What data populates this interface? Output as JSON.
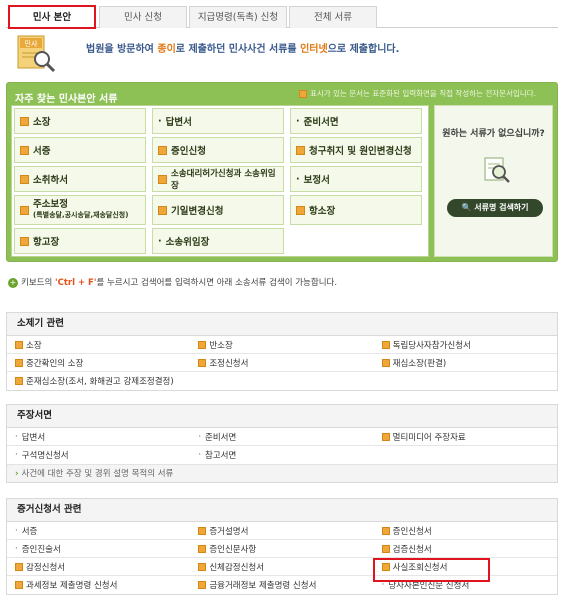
{
  "tabs": [
    {
      "label": "민사 본안"
    },
    {
      "label": "민사 신청"
    },
    {
      "label": "지급명령(독촉) 신청"
    },
    {
      "label": "전체 서류"
    }
  ],
  "intro": {
    "icon_label": "민사",
    "text_a": "법원을 방문하여 ",
    "text_b": "종이",
    "text_c": "로 제출하던 민사사건 서류를 ",
    "text_d": "인터넷",
    "text_e": "으로 제출합니다."
  },
  "favorites": {
    "title": "자주 찾는 민사본안 서류",
    "note": "표시가 있는 문서는 표준화된 입력화면을 직접 작성하는 전자문서입니다.",
    "items": [
      {
        "label": "소장",
        "icon": "doc-icon"
      },
      {
        "label": "답변서",
        "icon": "dot"
      },
      {
        "label": "준비서면",
        "icon": "dot"
      },
      {
        "label": "서증",
        "icon": "doc-icon"
      },
      {
        "label": "증인신청",
        "icon": "doc-icon"
      },
      {
        "label": "청구취지 및 원인변경신청",
        "icon": "doc-icon"
      },
      {
        "label": "소취하서",
        "icon": "doc-icon"
      },
      {
        "label": "소송대리허가신청과 소송위임장",
        "icon": "doc-icon"
      },
      {
        "label": "보정서",
        "icon": "dot"
      },
      {
        "label": "주소보정",
        "sub": "(특별송달,공시송달,재송달신청)",
        "icon": "doc-icon"
      },
      {
        "label": "기일변경신청",
        "icon": "doc-icon"
      },
      {
        "label": "항소장",
        "icon": "doc-icon"
      },
      {
        "label": "항고장",
        "icon": "doc-icon"
      },
      {
        "label": "소송위임장",
        "icon": "dot"
      }
    ],
    "side_text": "원하는 서류가 없으십니까?",
    "search_button": "서류명 검색하기"
  },
  "tip": {
    "a": "키보드의 ",
    "key": "'Ctrl + F'",
    "b": "를 누르시고 검색어를 입력하시면 아래 소송서류 검색이 가능합니다."
  },
  "sections": [
    {
      "title": "소제기 관련",
      "rows": [
        [
          {
            "label": "소장",
            "icon": "doc-icon"
          },
          {
            "label": "반소장",
            "icon": "doc-icon"
          },
          {
            "label": "독립당사자참가신청서",
            "icon": "doc-icon"
          }
        ],
        [
          {
            "label": "중간확인의 소장",
            "icon": "doc-icon"
          },
          {
            "label": "조정신청서",
            "icon": "doc-icon"
          },
          {
            "label": "재심소장(판결)",
            "icon": "doc-icon"
          }
        ],
        [
          {
            "label": "준재심소장(조서, 화해권고 강제조정결정)",
            "icon": "doc-icon"
          },
          {
            "label": "",
            "icon": ""
          },
          {
            "label": "",
            "icon": ""
          }
        ]
      ]
    },
    {
      "title": "주장서면",
      "rows": [
        [
          {
            "label": "답변서",
            "icon": "dot"
          },
          {
            "label": "준비서면",
            "icon": "dot"
          },
          {
            "label": "멀티미디어 주장자료",
            "icon": "doc-icon"
          }
        ],
        [
          {
            "label": "구석명신청서",
            "icon": "dot"
          },
          {
            "label": "참고서면",
            "icon": "dot"
          },
          {
            "label": "",
            "icon": ""
          }
        ]
      ],
      "note": "사건에 대한 주장 및 경위 설명 목적의 서류"
    },
    {
      "title": "증거신청서 관련",
      "rows": [
        [
          {
            "label": "서증",
            "icon": "dot"
          },
          {
            "label": "증거설명서",
            "icon": "doc-icon"
          },
          {
            "label": "증인신청서",
            "icon": "doc-icon"
          }
        ],
        [
          {
            "label": "증인진술서",
            "icon": "dot"
          },
          {
            "label": "증인신문사항",
            "icon": "doc-icon"
          },
          {
            "label": "검증신청서",
            "icon": "doc-icon"
          }
        ],
        [
          {
            "label": "감정신청서",
            "icon": "doc-icon"
          },
          {
            "label": "신체감정신청서",
            "icon": "doc-icon"
          },
          {
            "label": "사실조회신청서",
            "icon": "doc-icon"
          }
        ],
        [
          {
            "label": "과세정보 제출명령 신청서",
            "icon": "doc-icon"
          },
          {
            "label": "금융거래정보 제출명령 신청서",
            "icon": "doc-icon"
          },
          {
            "label": "당사자본인신문 신청서",
            "icon": "dot"
          }
        ]
      ]
    }
  ]
}
